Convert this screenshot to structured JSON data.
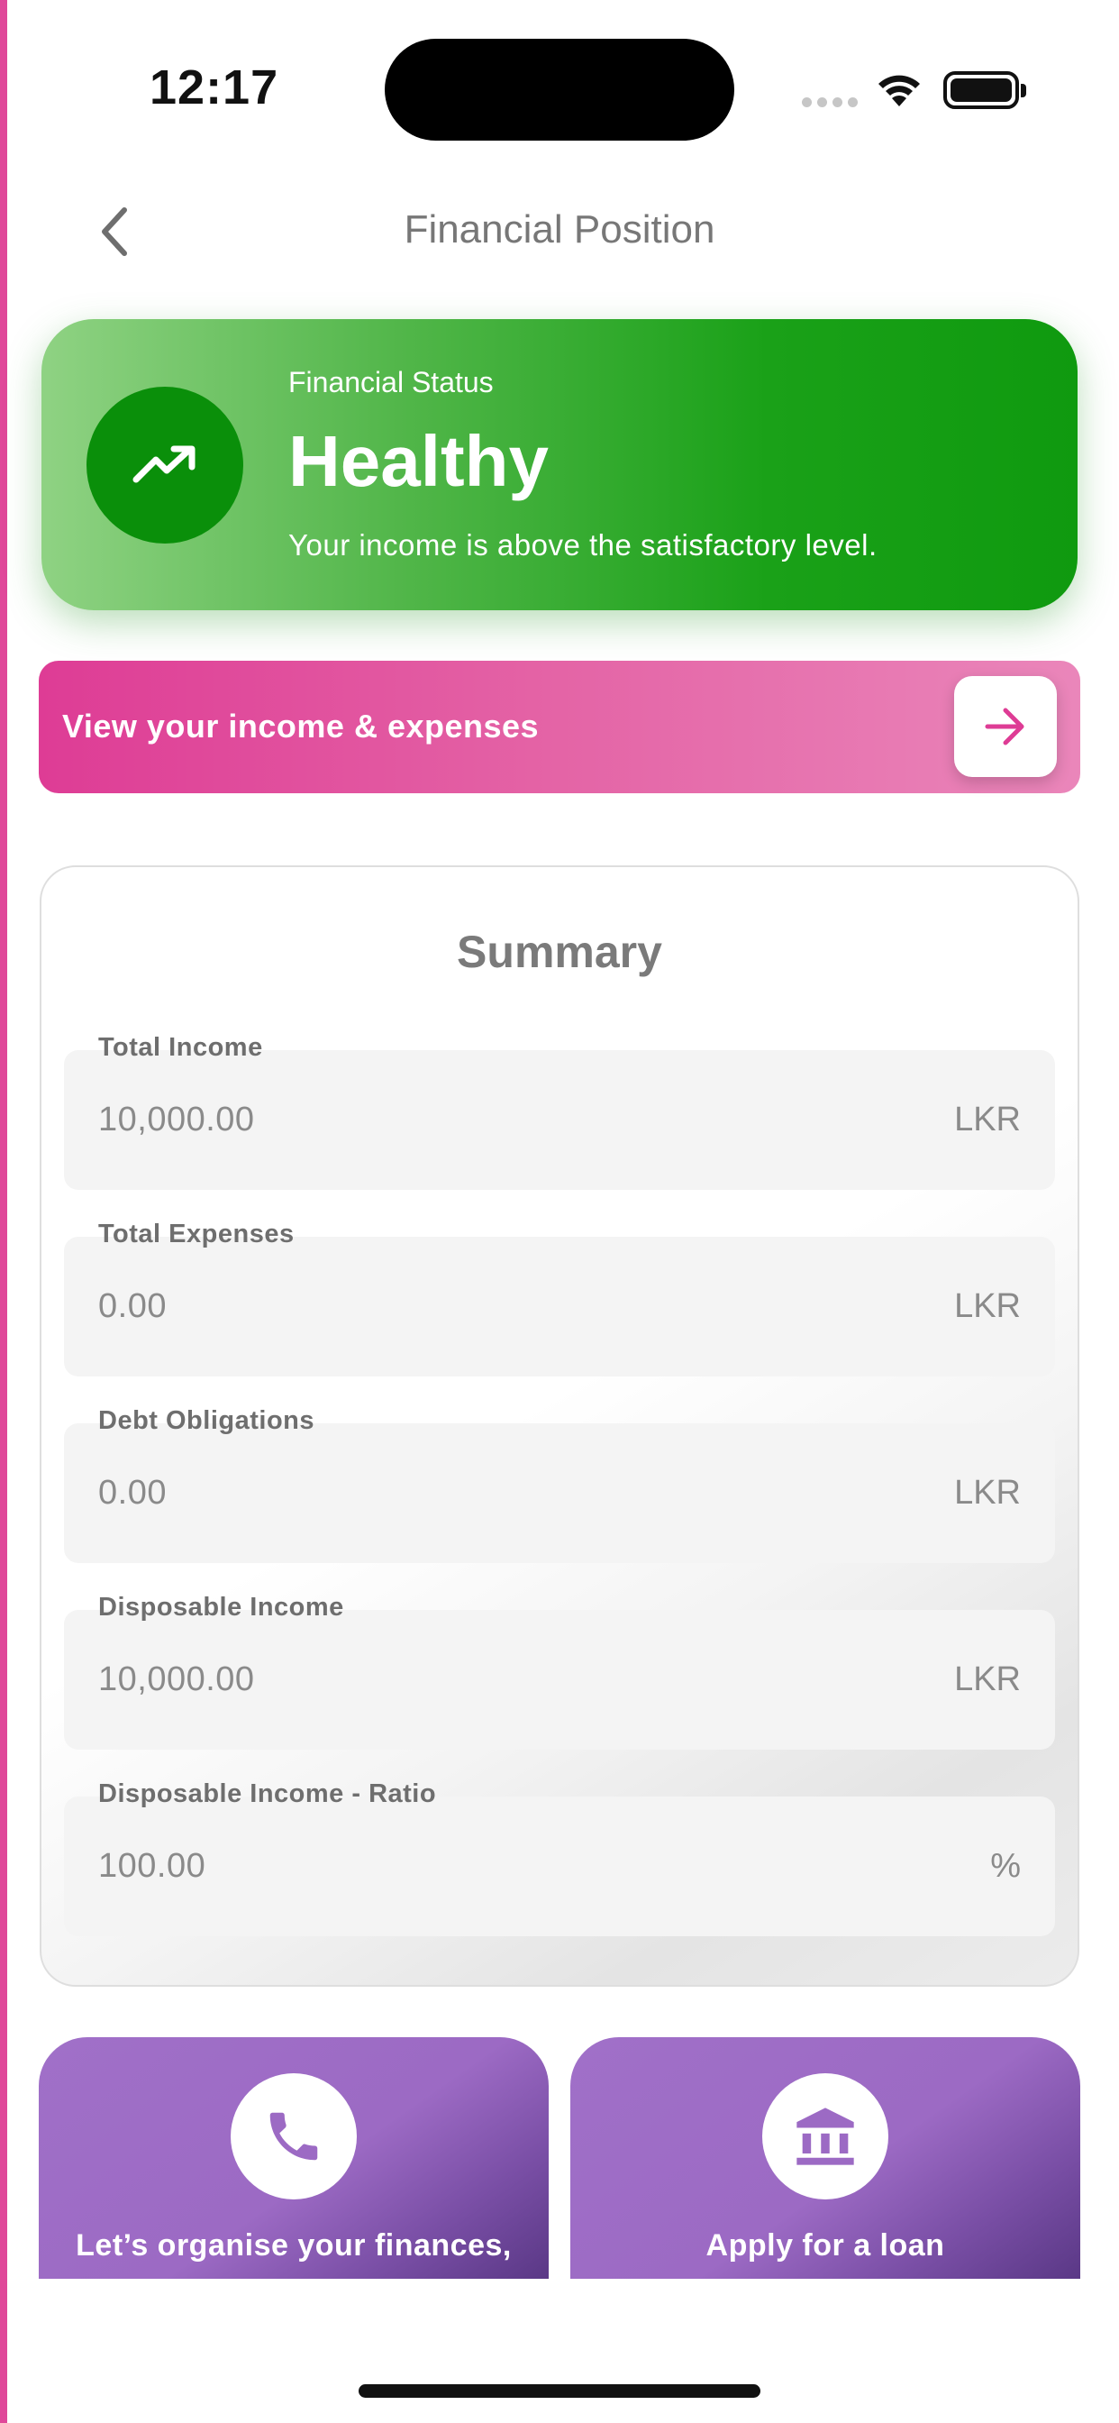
{
  "status_bar": {
    "time": "12:17"
  },
  "header": {
    "title": "Financial Position",
    "back_icon": "chevron-left-icon"
  },
  "financial_status": {
    "label": "Financial Status",
    "value": "Healthy",
    "description": "Your income is above the satisfactory level.",
    "icon": "trending-up-icon",
    "color": "#0f9a0f"
  },
  "income_expenses_banner": {
    "label": "View your income & expenses",
    "icon": "arrow-right-icon",
    "color": "#de3c95"
  },
  "summary": {
    "title": "Summary",
    "fields": [
      {
        "label": "Total Income",
        "value": "10,000.00",
        "unit": "LKR"
      },
      {
        "label": "Total Expenses",
        "value": "0.00",
        "unit": "LKR"
      },
      {
        "label": "Debt Obligations",
        "value": "0.00",
        "unit": "LKR"
      },
      {
        "label": "Disposable Income",
        "value": "10,000.00",
        "unit": "LKR"
      },
      {
        "label": "Disposable Income - Ratio",
        "value": "100.00",
        "unit": "%"
      }
    ]
  },
  "actions": [
    {
      "label": "Let’s organise your finances,",
      "icon": "phone-icon"
    },
    {
      "label": "Apply for a loan",
      "icon": "bank-icon"
    }
  ],
  "accent_colors": {
    "purple": "#9c6ac4",
    "pink": "#e0489a",
    "green": "#0f9a0f"
  }
}
